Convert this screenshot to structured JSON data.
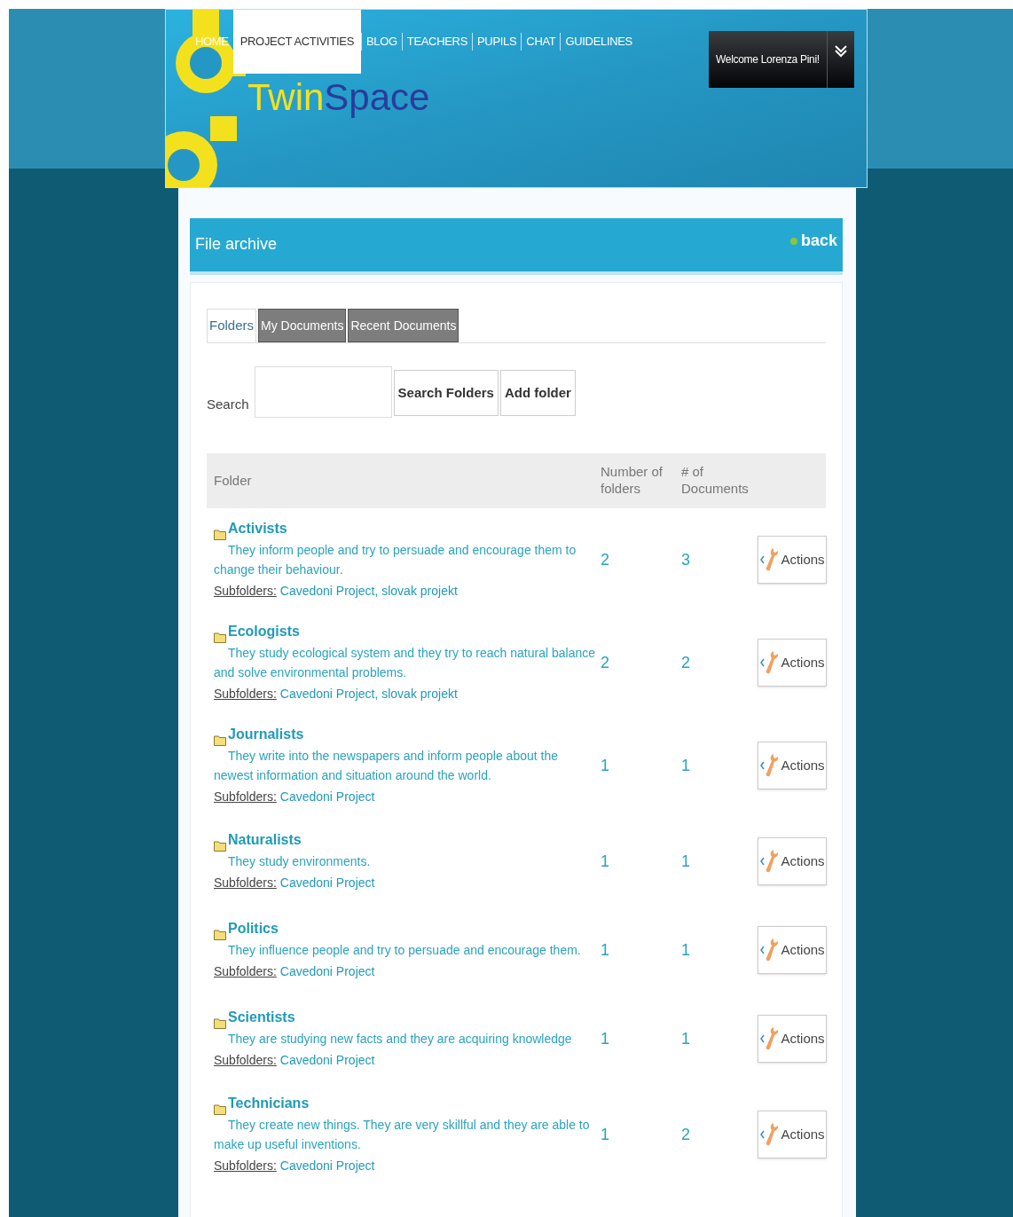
{
  "header": {
    "logo_text": "TwinSpace",
    "nav": [
      {
        "label": "HOME",
        "selected": false
      },
      {
        "label": "PROJECT ACTIVITIES",
        "selected": true
      },
      {
        "label": "BLOG",
        "selected": false
      },
      {
        "label": "TEACHERS",
        "selected": false
      },
      {
        "label": "PUPILS",
        "selected": false
      },
      {
        "label": "CHAT",
        "selected": false
      },
      {
        "label": "GUIDELINES",
        "selected": false
      }
    ],
    "user_button": "Welcome Lorenza Pini!"
  },
  "panel": {
    "title": "File archive",
    "back_link": "back"
  },
  "tabs": [
    {
      "label": "Folders",
      "selected": true
    },
    {
      "label": "My Documents",
      "selected": false
    },
    {
      "label": "Recent Documents",
      "selected": false
    }
  ],
  "search": {
    "label": "Search",
    "buttons": [
      "Search Folders",
      "Add folder"
    ]
  },
  "table": {
    "columns": [
      "Folder",
      "Number of folders",
      "# of Documents"
    ],
    "rows": [
      {
        "name": "Activists",
        "description": "They inform people and try to persuade and encourage them to change their behaviour.",
        "subfolders_label": "Subfolders:",
        "subfolders": "Cavedoni Project, slovak projekt",
        "folders": "2",
        "documents": "3",
        "action": "Actions"
      },
      {
        "name": "Ecologists",
        "description": "They study ecological system and they try to reach natural balance and solve environmental problems.",
        "subfolders_label": "Subfolders:",
        "subfolders": "Cavedoni Project, slovak projekt",
        "folders": "2",
        "documents": "2",
        "action": "Actions"
      },
      {
        "name": "Journalists",
        "description": "They write into the newspapers and inform people about the newest information and situation around the world.",
        "subfolders_label": "Subfolders:",
        "subfolders": "Cavedoni Project",
        "folders": "1",
        "documents": "1",
        "action": "Actions"
      },
      {
        "name": "Naturalists",
        "description": "They study environments.",
        "subfolders_label": "Subfolders:",
        "subfolders": "Cavedoni Project",
        "folders": "1",
        "documents": "1",
        "action": "Actions"
      },
      {
        "name": "Politics",
        "description": "They influence people and try to persuade and encourage them.",
        "subfolders_label": "Subfolders:",
        "subfolders": "Cavedoni Project",
        "folders": "1",
        "documents": "1",
        "action": "Actions"
      },
      {
        "name": "Scientists",
        "description": "They are studying new facts and they are acquiring knowledge",
        "subfolders_label": "Subfolders:",
        "subfolders": "Cavedoni Project",
        "folders": "1",
        "documents": "1",
        "action": "Actions"
      },
      {
        "name": "Technicians",
        "description": "They create new things. They are very skillful and they are able to make up useful inventions.",
        "subfolders_label": "Subfolders:",
        "subfolders": "Cavedoni Project",
        "folders": "1",
        "documents": "2",
        "action": "Actions"
      }
    ]
  }
}
